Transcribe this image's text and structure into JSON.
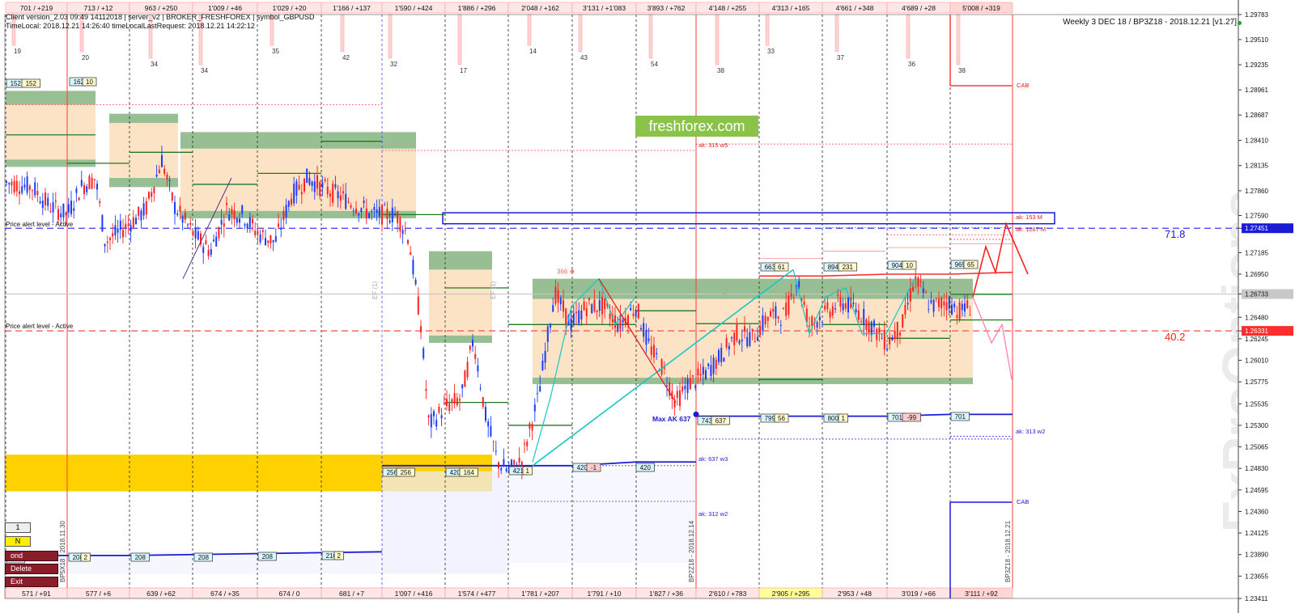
{
  "info": {
    "line1": "Client version_2.03 09:49 14112018 | server_v2 | BROKER_FRESHFOREX | symbol_GBPUSD",
    "line2": "TimeLocal: 2018.12.21 14:26:40 timeLocalLastRequest: 2018.12.21 14:22:12",
    "title": "Weekly 3 DEC 18 / BP3Z18 - 2018.12.21 [v1.27]",
    "watermark": "FxProOptions",
    "banner": "freshforex.com",
    "alert1": "Price alert level - Active",
    "alert2": "Price alert level - Active",
    "pct_high": "71.8",
    "pct_low": "40.2",
    "max_label": "Max AK 637",
    "level_366": "366"
  },
  "buttons": {
    "b1": "1",
    "bn": "N",
    "bdel": "Delete",
    "bexit": "Exit",
    "bhidden": "ond"
  },
  "colors": {
    "accent_red": "#ff3b3b",
    "accent_blue": "#1b1bd6",
    "zone_peach": "#fde3c5",
    "zone_green": "#86b98a",
    "zone_yellow": "#ffd100",
    "banner_bg": "#8bc34a"
  },
  "chart_data": {
    "type": "candlestick",
    "symbol": "GBPUSD",
    "ylim": [
      1.23411,
      1.29783
    ],
    "y_ticks": [
      "1.29783",
      "1.29510",
      "1.29235",
      "1.28961",
      "1.28687",
      "1.28410",
      "1.28135",
      "1.27860",
      "1.27590",
      "1.27451",
      "1.27185",
      "1.26950",
      "1.26733",
      "1.26480",
      "1.26331",
      "1.26245",
      "1.26010",
      "1.25775",
      "1.25535",
      "1.25300",
      "1.25065",
      "1.24830",
      "1.24595",
      "1.24360",
      "1.24125",
      "1.23890",
      "1.23655",
      "1.23411"
    ],
    "tick_highlight": {
      "blue": "1.27451",
      "gray": "1.26733",
      "red": "1.26331"
    },
    "top_labels": [
      "701 / +219",
      "713 / +12",
      "963 / +250",
      "1'009 / +46",
      "1'029 / +20",
      "1'166 / +137",
      "1'590 / +424",
      "1'886 / +296",
      "2'048 / +162",
      "3'131 / +1'083",
      "3'893 / +762",
      "4'148 / +255",
      "4'313 / +165",
      "4'661 / +348",
      "4'689 / +28",
      "5'008 / +319"
    ],
    "bottom_labels": [
      "571 / +91",
      "577 / +6",
      "639 / +62",
      "674 / +35",
      "674 / 0",
      "681 / +7",
      "1'097 / +416",
      "1'574 / +477",
      "1'781 / +207",
      "1'791 / +10",
      "1'827 / +36",
      "2'610 / +783",
      "2'905 / +295",
      "2'953 / +48",
      "3'019 / +66",
      "3'111 / +92"
    ],
    "session_nums": [
      "19",
      "20",
      "34",
      "34",
      "35",
      "42",
      "32",
      "17",
      "14",
      "43",
      "54",
      "38",
      "33",
      "37",
      "36",
      "38"
    ],
    "box_labels_top": [
      "152",
      "152",
      "162",
      "10",
      "663",
      "61",
      "894",
      "231",
      "904",
      "10",
      "969",
      "65"
    ],
    "box_labels_mid": [
      "743",
      "637",
      "799",
      "56",
      "800",
      "1",
      "701",
      "-99",
      "701"
    ],
    "box_labels_low": [
      "256",
      "256",
      "420",
      "164",
      "421",
      "1",
      "420",
      "-1",
      "420"
    ],
    "box_labels_bot": [
      "206",
      "208",
      "2",
      "208",
      "208",
      "208",
      "210",
      "2"
    ],
    "annotations": [
      "ak: 315 w5",
      "ak: 153 M",
      "ak: 1267 M",
      "ak: 637 w3",
      "ak: 313 w2",
      "ak: 312 w2",
      "CAB",
      "CAB"
    ],
    "vertical_labels": [
      "BP5X18 - 2018.11.30",
      "BP2Z18 - 2018.12.14",
      "BP3Z18 - 2018.12.21",
      "EF (1)",
      "EF (1)",
      "EF (1)"
    ],
    "price_levels": {
      "alert_high": 1.27451,
      "alert_low": 1.26331,
      "last": 1.26733
    }
  }
}
